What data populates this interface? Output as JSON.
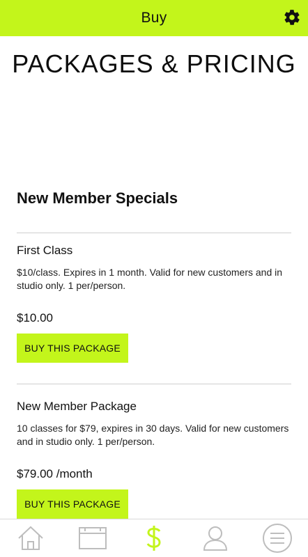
{
  "header": {
    "title": "Buy",
    "settings_icon": "gear-icon",
    "accent_color": "#c3f51b"
  },
  "page": {
    "title": "PACKAGES & PRICING"
  },
  "section": {
    "title": "New Member Specials"
  },
  "packages": [
    {
      "name": "First Class",
      "description": "$10/class. Expires in 1 month. Valid for new customers and in studio only. 1 per/person.",
      "price": "$10.00",
      "button_label": "BUY THIS PACKAGE"
    },
    {
      "name": "New Member Package",
      "description": "10 classes for $79, expires in 30 days. Valid for new customers and in studio only. 1 per/person.",
      "price": "$79.00 /month",
      "button_label": "BUY THIS PACKAGE"
    }
  ],
  "bottom_nav": {
    "items": [
      {
        "icon": "home-icon",
        "active": false
      },
      {
        "icon": "calendar-icon",
        "active": false
      },
      {
        "icon": "dollar-icon",
        "active": true
      },
      {
        "icon": "profile-icon",
        "active": false
      },
      {
        "icon": "menu-icon",
        "active": false
      }
    ]
  }
}
